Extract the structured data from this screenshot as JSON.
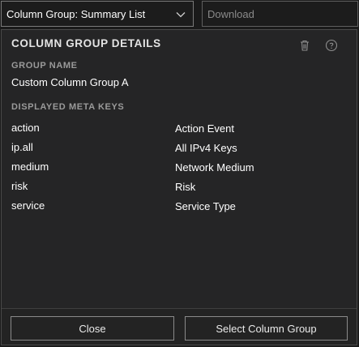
{
  "header": {
    "column_group_select": "Column Group: Summary List",
    "download_placeholder": "Download"
  },
  "panel": {
    "title": "COLUMN GROUP DETAILS",
    "group_name_label": "GROUP NAME",
    "group_name": "Custom Column Group A",
    "meta_keys_label": "DISPLAYED META KEYS",
    "meta_keys": [
      {
        "key": "action",
        "name": "Action Event"
      },
      {
        "key": "ip.all",
        "name": "All IPv4 Keys"
      },
      {
        "key": "medium",
        "name": "Network Medium"
      },
      {
        "key": "risk",
        "name": "Risk"
      },
      {
        "key": "service",
        "name": "Service Type"
      }
    ]
  },
  "footer": {
    "close_label": "Close",
    "select_label": "Select Column Group"
  },
  "icons": {
    "select_chevron": "chevron-down-icon",
    "delete": "trash-icon",
    "help": "help-icon"
  }
}
